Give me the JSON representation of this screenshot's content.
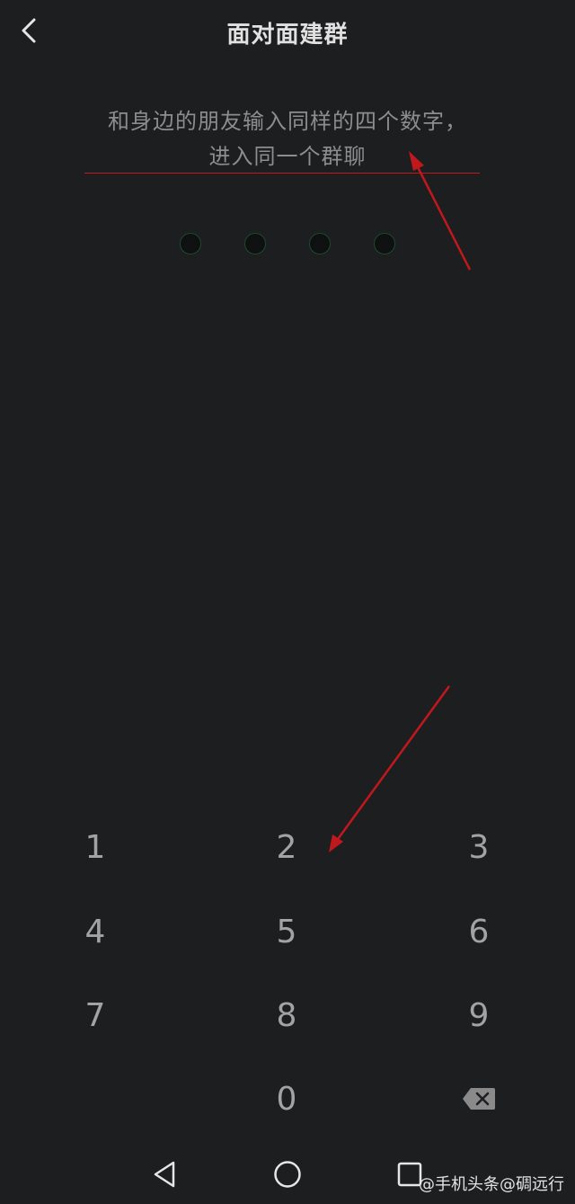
{
  "header": {
    "title": "面对面建群"
  },
  "instruction": {
    "line1": "和身边的朋友输入同样的四个数字，",
    "line2": "进入同一个群聊"
  },
  "code": {
    "length": 4,
    "entered": ""
  },
  "keypad": {
    "k1": "1",
    "k2": "2",
    "k3": "3",
    "k4": "4",
    "k5": "5",
    "k6": "6",
    "k7": "7",
    "k8": "8",
    "k9": "9",
    "k0": "0"
  },
  "watermark": {
    "text": "@手机头条@碉远行"
  },
  "colors": {
    "background": "#1d1e20",
    "annotation": "#c0181c",
    "dot_border": "#1d4a2a"
  }
}
